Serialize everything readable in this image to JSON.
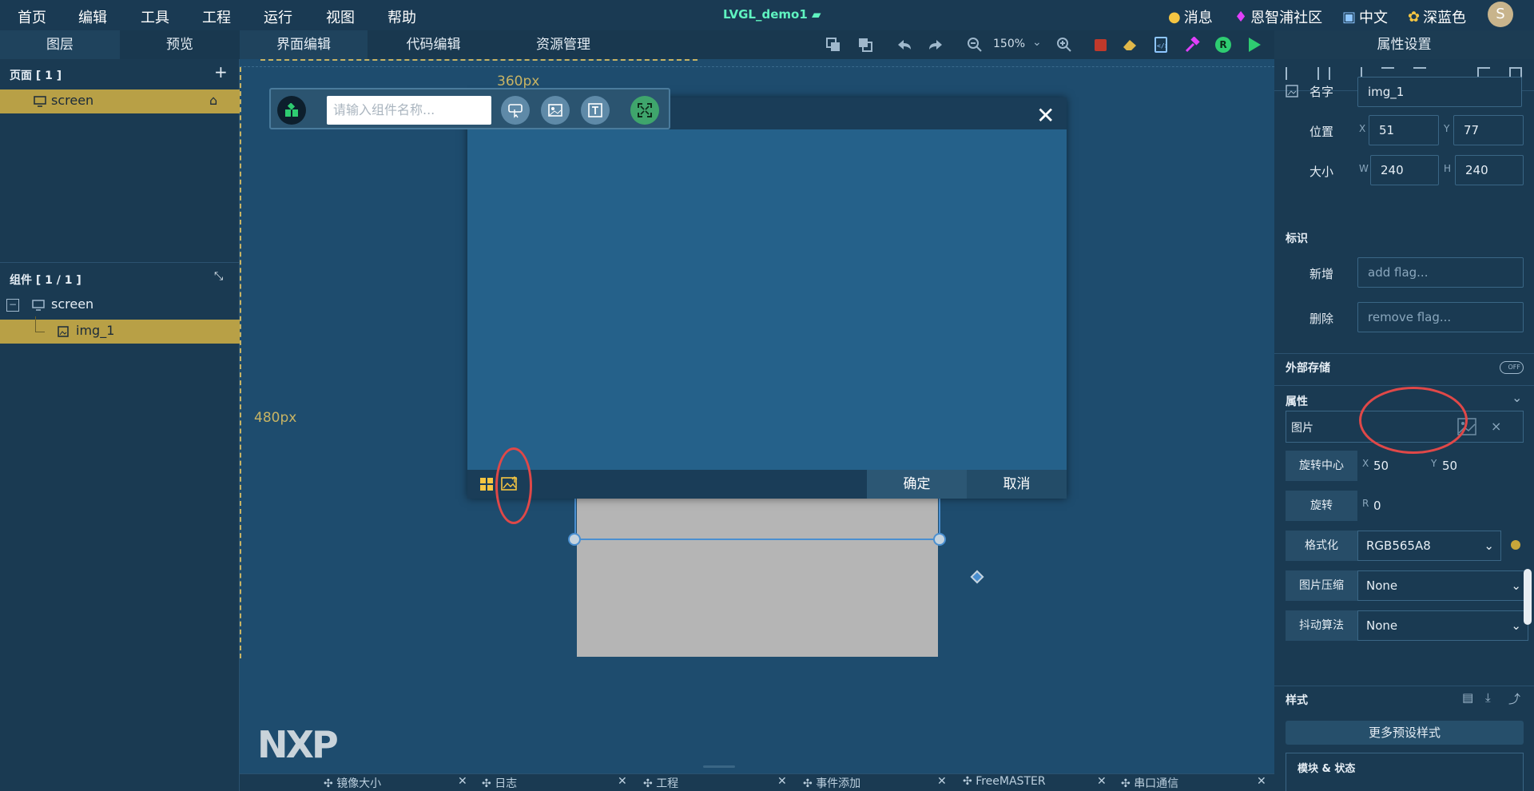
{
  "menu": [
    "首页",
    "编辑",
    "工具",
    "工程",
    "运行",
    "视图",
    "帮助"
  ],
  "app_title": "LVGL_demo1",
  "topright": {
    "messages": "消息",
    "community": "恩智浦社区",
    "lang": "中文",
    "theme": "深蓝色",
    "avatar": "S"
  },
  "left_tabs": [
    "图层",
    "预览"
  ],
  "center_tabs": [
    "界面编辑",
    "代码编辑",
    "资源管理"
  ],
  "zoom": "150%",
  "props_title": "属性设置",
  "pages": {
    "header": "页面 [ 1 ]",
    "item": "screen"
  },
  "components": {
    "header": "组件 [ 1 / 1 ]",
    "root": "screen",
    "child": "img_1"
  },
  "canvas": {
    "width_label": "360px",
    "height_label": "480px",
    "logo": "NXP"
  },
  "picker": {
    "placeholder": "请输入组件名称..."
  },
  "dialog": {
    "ok": "确定",
    "cancel": "取消"
  },
  "props": {
    "name_label": "名字",
    "name_value": "img_1",
    "pos_label": "位置",
    "x_label": "X",
    "x": "51",
    "y_label": "Y",
    "y": "77",
    "size_label": "大小",
    "w_label": "W",
    "w": "240",
    "h_label": "H",
    "h": "240",
    "flags_header": "标识",
    "add_label": "新增",
    "add_ph": "add flag...",
    "remove_label": "删除",
    "remove_ph": "remove flag...",
    "ext_storage": "外部存储",
    "toggle": "OFF",
    "attrs_header": "属性",
    "image_label": "图片",
    "image_clear": "×",
    "pivot_label": "旋转中心",
    "pivot_x": "50",
    "pivot_y": "50",
    "rotate_label": "旋转",
    "rotate_r": "R",
    "rotate_value": "0",
    "format_label": "格式化",
    "format_value": "RGB565A8",
    "compress_label": "图片压缩",
    "compress_value": "None",
    "dither_label": "抖动算法",
    "dither_value": "None",
    "style_header": "样式",
    "more_styles": "更多预设样式",
    "parts_header": "模块 & 状态"
  },
  "bottom_tabs": [
    "镜像大小",
    "日志",
    "工程",
    "事件添加",
    "FreeMASTER",
    "串口通信"
  ]
}
